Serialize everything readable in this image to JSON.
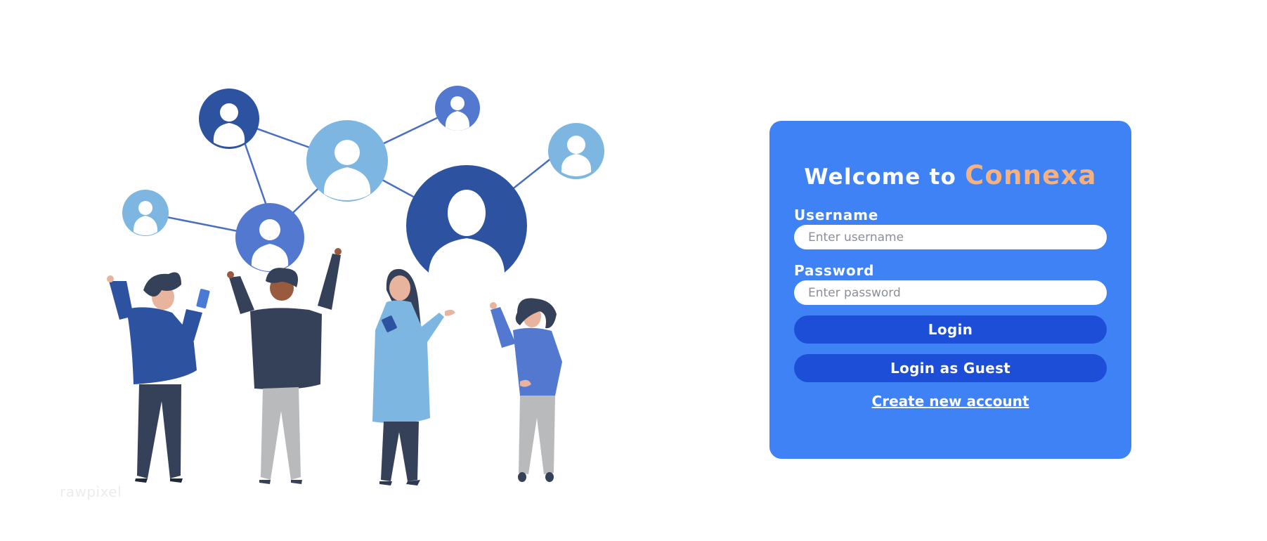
{
  "login_card": {
    "title_prefix": "Welcome to",
    "brand": "Connexa",
    "username_label": "Username",
    "username_placeholder": "Enter username",
    "username_value": "",
    "password_label": "Password",
    "password_placeholder": "Enter password",
    "password_value": "",
    "login_button": "Login",
    "guest_button": "Login as Guest",
    "create_account_link": "Create new account"
  },
  "illustration": {
    "watermark": "rawpixel"
  },
  "colors": {
    "card_background": "#3e82f5",
    "button": "#1d4ed8",
    "brand_accent": "#f6b17f",
    "node_dark": "#2c52a0",
    "node_medium": "#5279cf",
    "node_light": "#7db6e0",
    "figure_dark": "#344158",
    "figure_gray": "#b8babc"
  }
}
